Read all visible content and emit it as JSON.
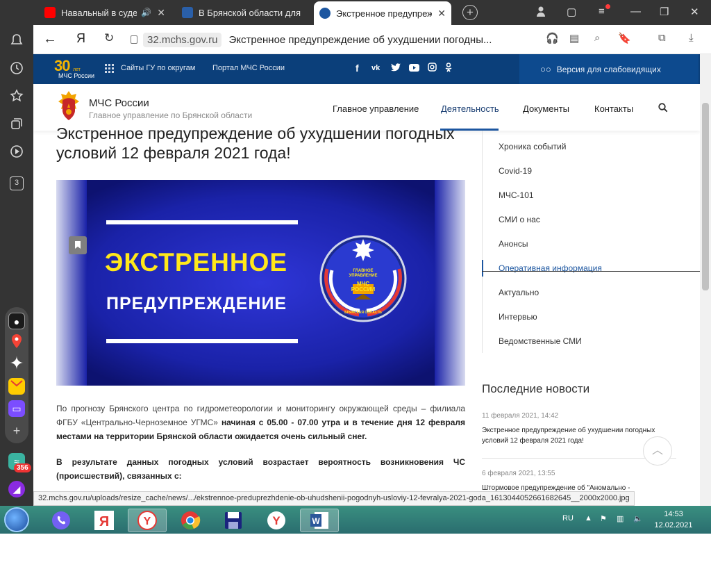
{
  "browser": {
    "tabs": [
      {
        "title": "Навальный в суде",
        "fav_color": "#ff0000",
        "icon": "youtube-icon"
      },
      {
        "title": "В Брянской области для б",
        "fav_color": "#2a5fa8",
        "icon": "news-icon"
      },
      {
        "title": "Экстренное предупреж",
        "fav_color": "#1c56a0",
        "icon": "mchs-icon"
      }
    ],
    "address": {
      "domain": "32.mchs.gov.ru",
      "page_title": "Экстренное предупреждение об ухудшении погодны..."
    },
    "side_badge": "356",
    "side_number": "3",
    "status_url": "32.mchs.gov.ru/uploads/resize_cache/news/.../ekstrennoe-preduprezhdenie-ob-uhudshenii-pogodnyh-usloviy-12-fevralya-2021-goda_1613044052661682645__2000x2000.jpg"
  },
  "site": {
    "topbar": {
      "logo_number": "30",
      "logo_small": "лет",
      "logo_text": "МЧС\nРоссии",
      "links": [
        "Сайты ГУ по округам",
        "Портал МЧС России"
      ],
      "social": [
        "f",
        "vk",
        "tw",
        "yt",
        "ig",
        "ok"
      ],
      "accessibility": "Версия для слабовидящих"
    },
    "header": {
      "org_name": "МЧС России",
      "org_sub": "Главное управление по Брянской области",
      "menu": [
        "Главное управление",
        "Деятельность",
        "Документы",
        "Контакты"
      ],
      "active_menu": "Деятельность"
    },
    "article": {
      "title": "Экстренное предупреждение об ухудшении погодных условий 12 февраля 2021 года!",
      "hero": {
        "line1": "ЭКСТРЕННОЕ",
        "line2": "ПРЕДУПРЕЖДЕНИЕ",
        "emblem_top": "ГЛАВНОЕ УПРАВЛЕНИЕ",
        "emblem_mid": "МЧС РОССИИ",
        "emblem_bottom": "БРЯНСКАЯ ОБЛАСТЬ"
      },
      "p1_normal": "По прогнозу Брянского центра по гидрометеорологии и мониторингу окружающей среды – филиала ФГБУ «Центрально-Черноземное УГМС»",
      "p1_bold": "начиная с 05.00 - 07.00 утра и в течение дня 12 февраля местами на территории Брянской области ожидается очень сильный снег.",
      "p2_bold": "В результате данных погодных условий возрастает вероятность возникновения ЧС (происшествий), связанных с:"
    },
    "sidebar": {
      "items": [
        "Хроника событий",
        "Covid-19",
        "МЧС-101",
        "СМИ о нас",
        "Анонсы",
        "Оперативная информация",
        "Актуально",
        "Интервью",
        "Ведомственные СМИ"
      ],
      "active": "Оперативная информация",
      "latest_title": "Последние новости",
      "news": [
        {
          "date": "11 февраля 2021, 14:42",
          "title": "Экстренное предупреждение об ухудшении погодных условий 12 февраля 2021 года!"
        },
        {
          "date": "6 февраля 2021, 13:55",
          "title": "Штормовое предупреждение об \"Аномально -"
        }
      ]
    }
  },
  "taskbar": {
    "lang": "RU",
    "time": "14:53",
    "date": "12.02.2021"
  }
}
